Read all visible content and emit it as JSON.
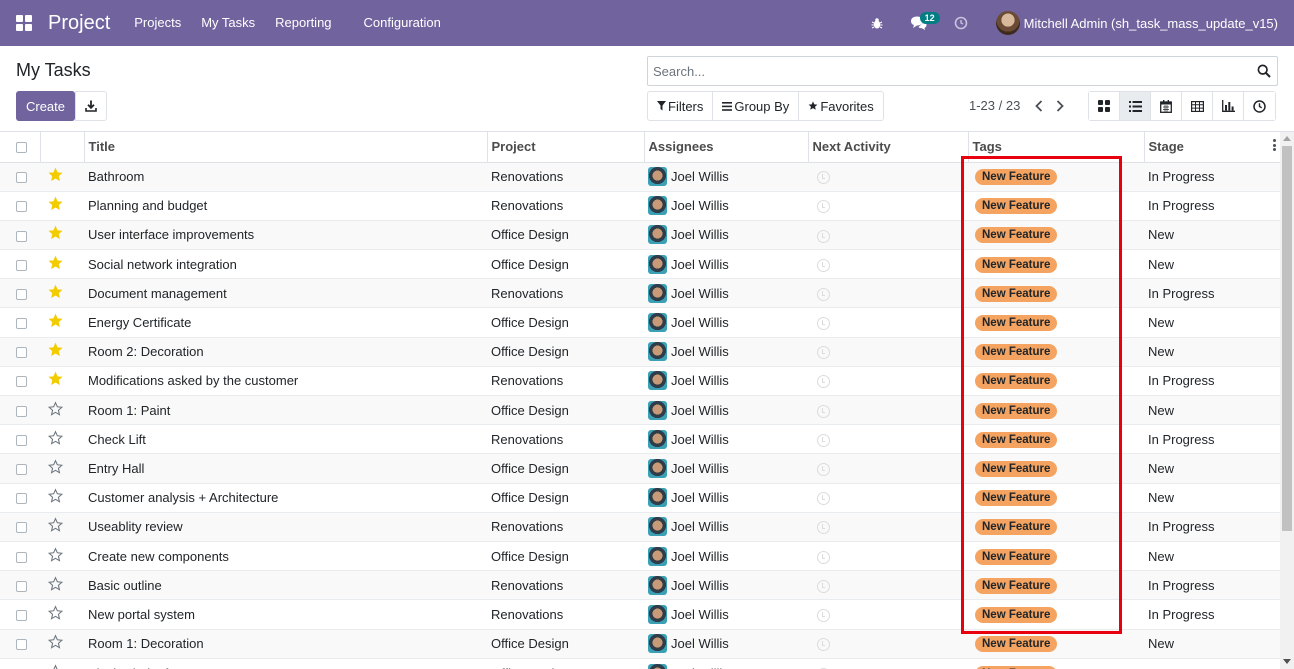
{
  "navbar": {
    "brand": "Project",
    "menus": [
      "Projects",
      "My Tasks",
      "Reporting",
      "Configuration"
    ],
    "messages_count": "12",
    "user_name": "Mitchell Admin (sh_task_mass_update_v15)"
  },
  "control_panel": {
    "title": "My Tasks",
    "create_label": "Create",
    "search_placeholder": "Search...",
    "filters_label": "Filters",
    "groupby_label": "Group By",
    "favorites_label": "Favorites",
    "pager": "1-23 / 23"
  },
  "table": {
    "headers": {
      "title": "Title",
      "project": "Project",
      "assignees": "Assignees",
      "activity": "Next Activity",
      "tags": "Tags",
      "stage": "Stage"
    },
    "rows": [
      {
        "starred": true,
        "title": "Bathroom",
        "project": "Renovations",
        "assignee": "Joel Willis",
        "tag": "New Feature",
        "stage": "In Progress"
      },
      {
        "starred": true,
        "title": "Planning and budget",
        "project": "Renovations",
        "assignee": "Joel Willis",
        "tag": "New Feature",
        "stage": "In Progress"
      },
      {
        "starred": true,
        "title": "User interface improvements",
        "project": "Office Design",
        "assignee": "Joel Willis",
        "tag": "New Feature",
        "stage": "New"
      },
      {
        "starred": true,
        "title": "Social network integration",
        "project": "Office Design",
        "assignee": "Joel Willis",
        "tag": "New Feature",
        "stage": "New"
      },
      {
        "starred": true,
        "title": "Document management",
        "project": "Renovations",
        "assignee": "Joel Willis",
        "tag": "New Feature",
        "stage": "In Progress"
      },
      {
        "starred": true,
        "title": "Energy Certificate",
        "project": "Office Design",
        "assignee": "Joel Willis",
        "tag": "New Feature",
        "stage": "New"
      },
      {
        "starred": true,
        "title": "Room 2: Decoration",
        "project": "Office Design",
        "assignee": "Joel Willis",
        "tag": "New Feature",
        "stage": "New"
      },
      {
        "starred": true,
        "title": "Modifications asked by the customer",
        "project": "Renovations",
        "assignee": "Joel Willis",
        "tag": "New Feature",
        "stage": "In Progress"
      },
      {
        "starred": false,
        "title": "Room 1: Paint",
        "project": "Office Design",
        "assignee": "Joel Willis",
        "tag": "New Feature",
        "stage": "New"
      },
      {
        "starred": false,
        "title": "Check Lift",
        "project": "Renovations",
        "assignee": "Joel Willis",
        "tag": "New Feature",
        "stage": "In Progress"
      },
      {
        "starred": false,
        "title": "Entry Hall",
        "project": "Office Design",
        "assignee": "Joel Willis",
        "tag": "New Feature",
        "stage": "New"
      },
      {
        "starred": false,
        "title": "Customer analysis + Architecture",
        "project": "Office Design",
        "assignee": "Joel Willis",
        "tag": "New Feature",
        "stage": "New"
      },
      {
        "starred": false,
        "title": "Useablity review",
        "project": "Renovations",
        "assignee": "Joel Willis",
        "tag": "New Feature",
        "stage": "In Progress"
      },
      {
        "starred": false,
        "title": "Create new components",
        "project": "Office Design",
        "assignee": "Joel Willis",
        "tag": "New Feature",
        "stage": "New"
      },
      {
        "starred": false,
        "title": "Basic outline",
        "project": "Renovations",
        "assignee": "Joel Willis",
        "tag": "New Feature",
        "stage": "In Progress"
      },
      {
        "starred": false,
        "title": "New portal system",
        "project": "Renovations",
        "assignee": "Joel Willis",
        "tag": "New Feature",
        "stage": "In Progress"
      },
      {
        "starred": false,
        "title": "Room 1: Decoration",
        "project": "Office Design",
        "assignee": "Joel Willis",
        "tag": "New Feature",
        "stage": "New"
      },
      {
        "starred": false,
        "title": "Black Chairs for managers",
        "project": "Office Design",
        "assignee": "Joel Willis",
        "tag": "New Feature",
        "stage": "New"
      }
    ]
  },
  "colors": {
    "brand": "#71639e",
    "star_filled": "#f3cc00",
    "tag_bg": "#f4a460",
    "highlight": "#e8000f"
  }
}
